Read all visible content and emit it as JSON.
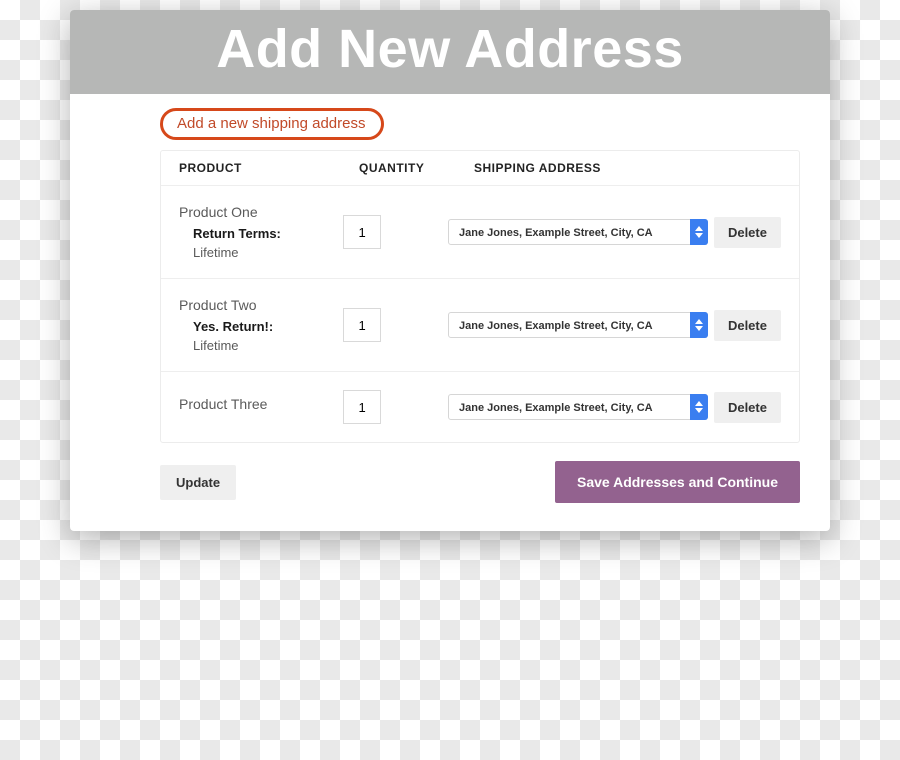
{
  "title": "Add New Address",
  "link_add": "Add a new shipping address",
  "headers": {
    "product": "PRODUCT",
    "quantity": "QUANTITY",
    "address": "SHIPPING ADDRESS"
  },
  "rows": [
    {
      "name": "Product One",
      "attr_label": "Return Terms:",
      "attr_value": "Lifetime",
      "qty": "1",
      "address": "Jane Jones, Example Street, City, CA",
      "delete": "Delete"
    },
    {
      "name": "Product Two",
      "attr_label": "Yes. Return!:",
      "attr_value": "Lifetime",
      "qty": "1",
      "address": "Jane Jones, Example Street, City, CA",
      "delete": "Delete"
    },
    {
      "name": "Product Three",
      "attr_label": "",
      "attr_value": "",
      "qty": "1",
      "address": "Jane Jones, Example Street, City, CA",
      "delete": "Delete"
    }
  ],
  "buttons": {
    "update": "Update",
    "save": "Save Addresses and Continue"
  }
}
